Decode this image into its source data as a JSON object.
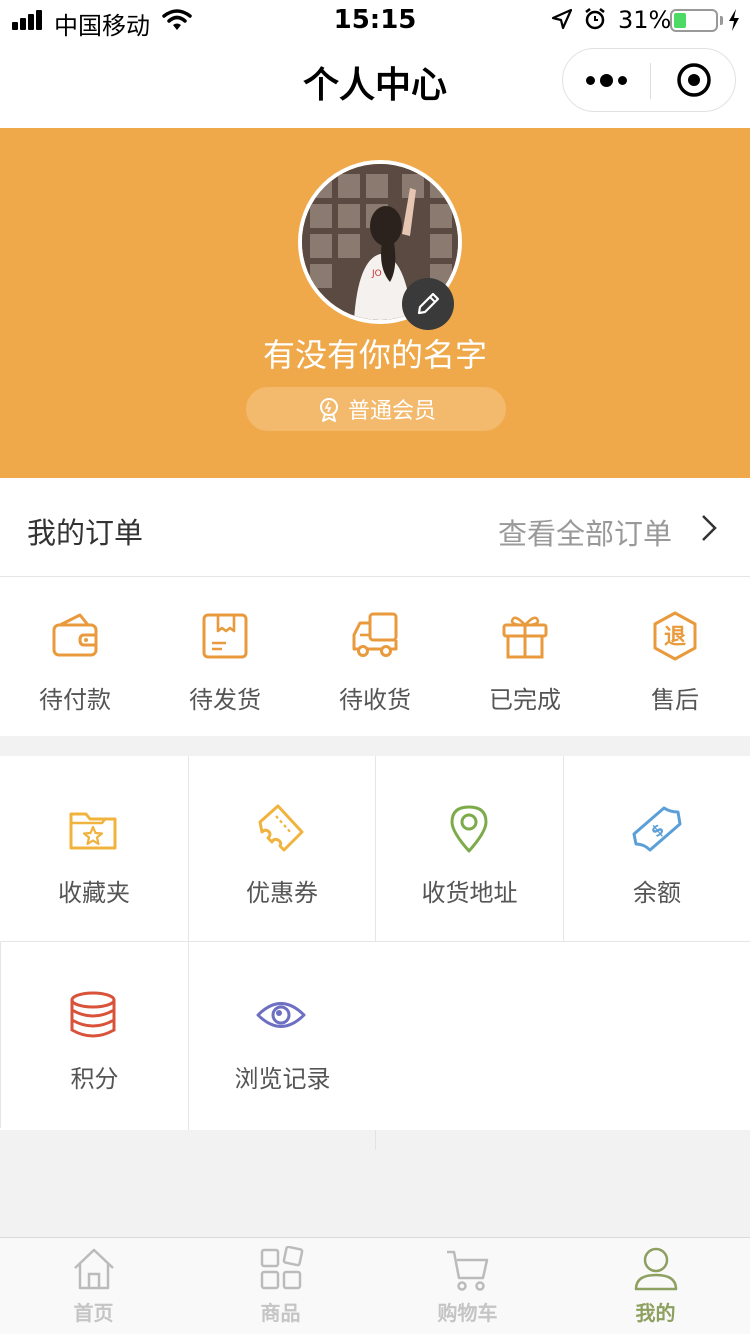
{
  "status_bar": {
    "carrier": "中国移动",
    "time": "15:15",
    "battery_percent": "31%",
    "battery_level": 0.31
  },
  "nav": {
    "title": "个人中心"
  },
  "profile": {
    "nickname": "有没有你的名字",
    "member_level": "普通会员"
  },
  "orders": {
    "title": "我的订单",
    "view_all": "查看全部订单",
    "items": [
      {
        "label": "待付款",
        "icon": "wallet-icon"
      },
      {
        "label": "待发货",
        "icon": "package-icon"
      },
      {
        "label": "待收货",
        "icon": "truck-icon"
      },
      {
        "label": "已完成",
        "icon": "gift-icon"
      },
      {
        "label": "售后",
        "icon": "refund-icon",
        "badge": "退"
      }
    ]
  },
  "tools": [
    {
      "label": "收藏夹",
      "icon": "favorites-folder-icon"
    },
    {
      "label": "优惠券",
      "icon": "coupon-icon"
    },
    {
      "label": "收货地址",
      "icon": "location-pin-icon"
    },
    {
      "label": "余额",
      "icon": "money-icon"
    },
    {
      "label": "积分",
      "icon": "coins-icon"
    },
    {
      "label": "浏览记录",
      "icon": "eye-icon"
    }
  ],
  "tabbar": [
    {
      "label": "首页",
      "icon": "home-icon",
      "active": false
    },
    {
      "label": "商品",
      "icon": "grid-icon",
      "active": false
    },
    {
      "label": "购物车",
      "icon": "cart-icon",
      "active": false
    },
    {
      "label": "我的",
      "icon": "user-icon",
      "active": true
    }
  ],
  "colors": {
    "banner": "#f0a94a",
    "icon_orange": "#e99a3c",
    "icon_yellow": "#f0b33e",
    "icon_green": "#7dab4a",
    "icon_blue": "#5b9fd8",
    "icon_red": "#d9533a",
    "icon_purple": "#6c6fc2",
    "tab_active": "#8da05f"
  }
}
